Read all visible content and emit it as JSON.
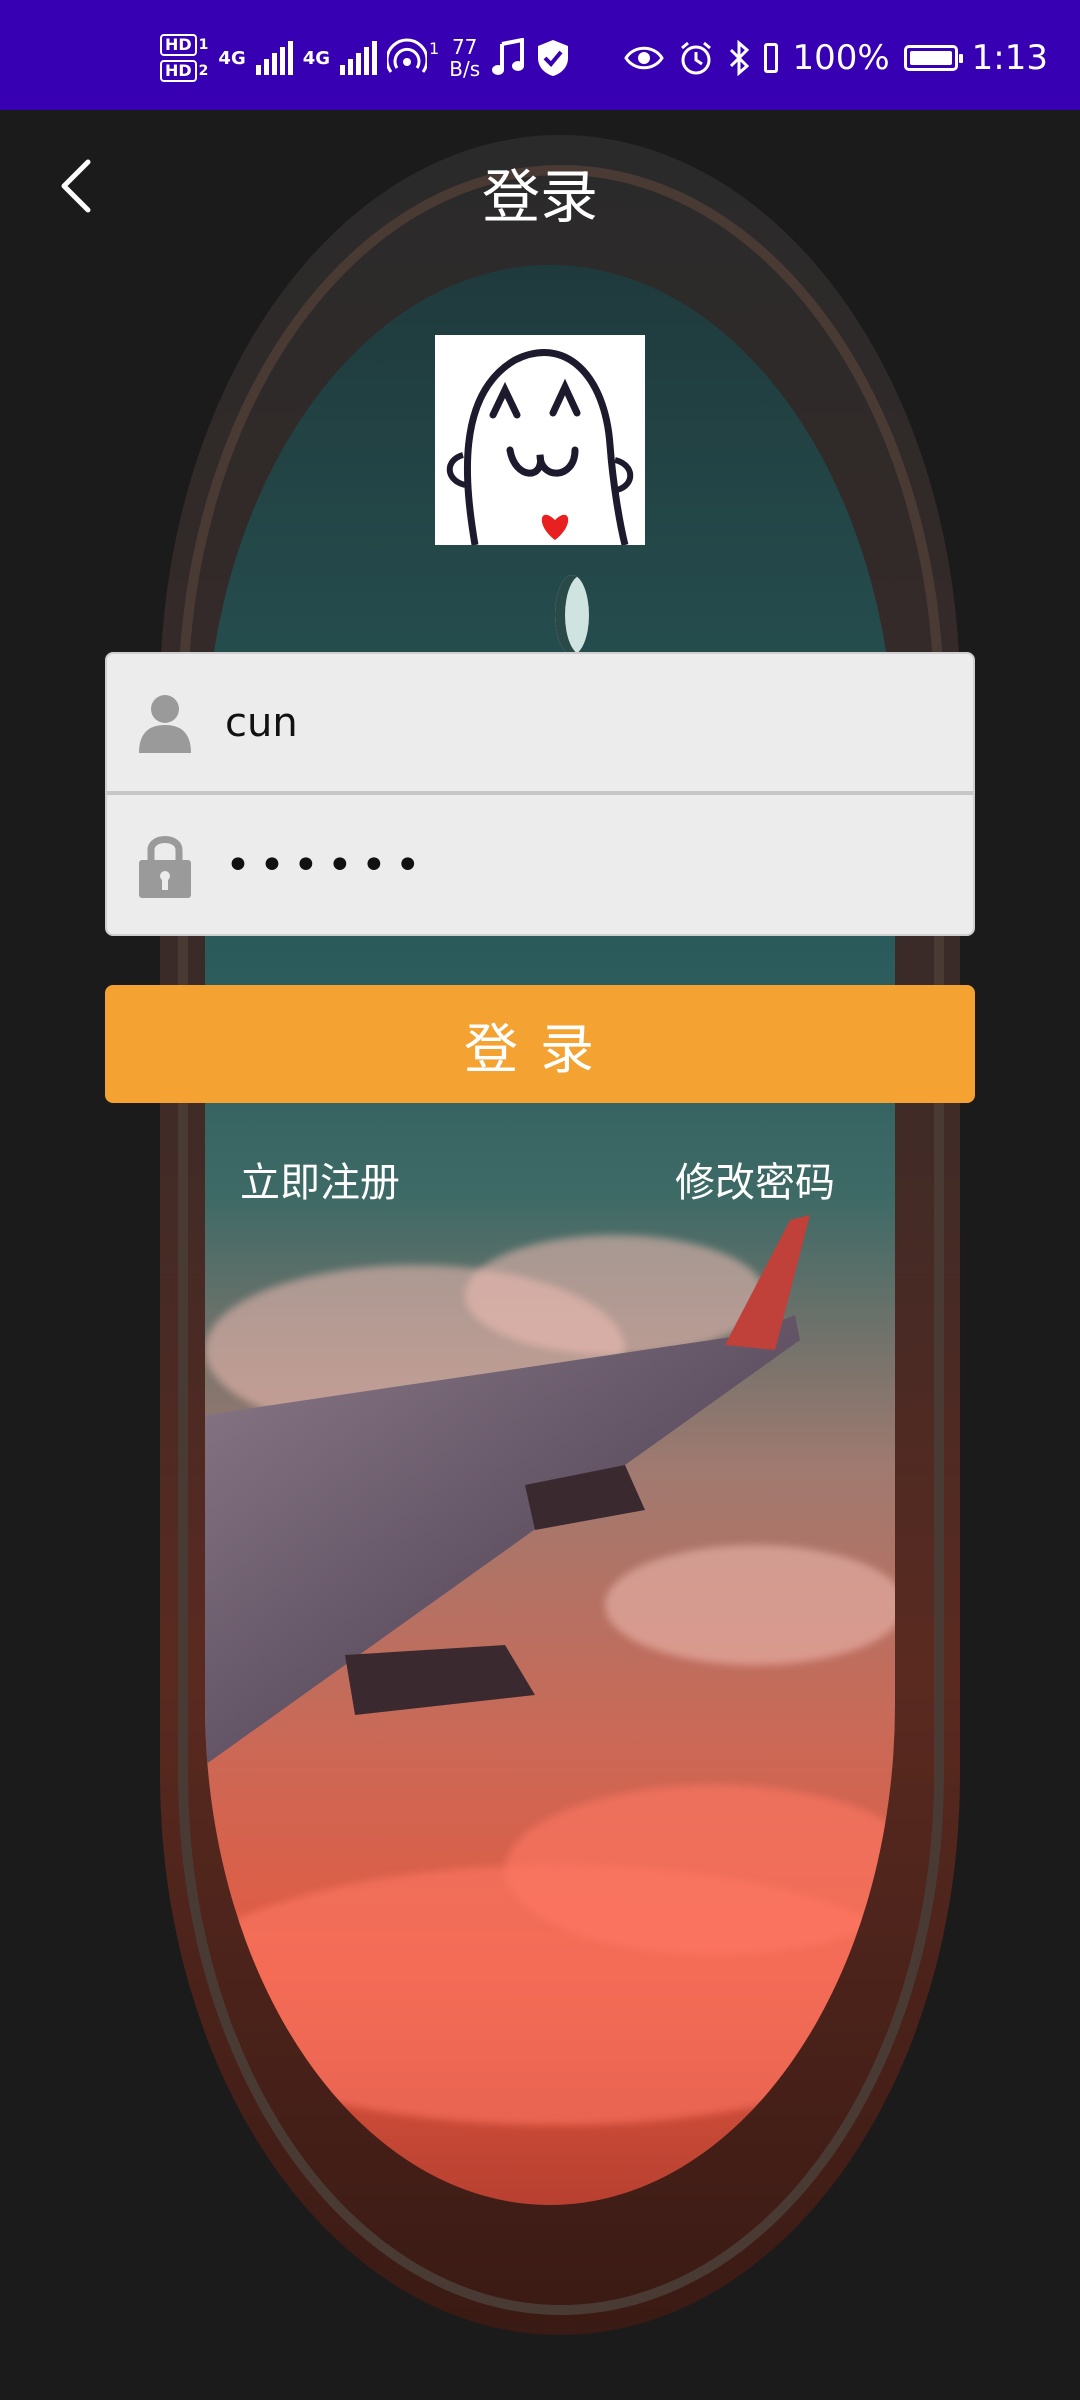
{
  "status_bar": {
    "hd1": "HD",
    "hd1_sub": "1",
    "hd2": "HD",
    "hd2_sub": "2",
    "net1": "4G",
    "net2": "4G",
    "hotspot_sub": "1",
    "speed_value": "77",
    "speed_unit": "B/s",
    "battery_percent": "100%",
    "battery_level": 1.0,
    "time": "1:13",
    "icons": [
      "music-icon",
      "shield-icon",
      "eye-icon",
      "alarm-icon",
      "bluetooth-icon",
      "battery-icon"
    ]
  },
  "app_bar": {
    "title": "登录",
    "back_icon": "chevron-left-icon"
  },
  "form": {
    "username_value": "cun",
    "username_icon": "user-icon",
    "password_value": "••••••",
    "password_icon": "lock-icon"
  },
  "actions": {
    "login_label": "登录",
    "register_label": "立即注册",
    "change_password_label": "修改密码"
  },
  "colors": {
    "status_bar": "#3700b3",
    "login_button": "#f4a231",
    "background": "#1b1b1b"
  }
}
